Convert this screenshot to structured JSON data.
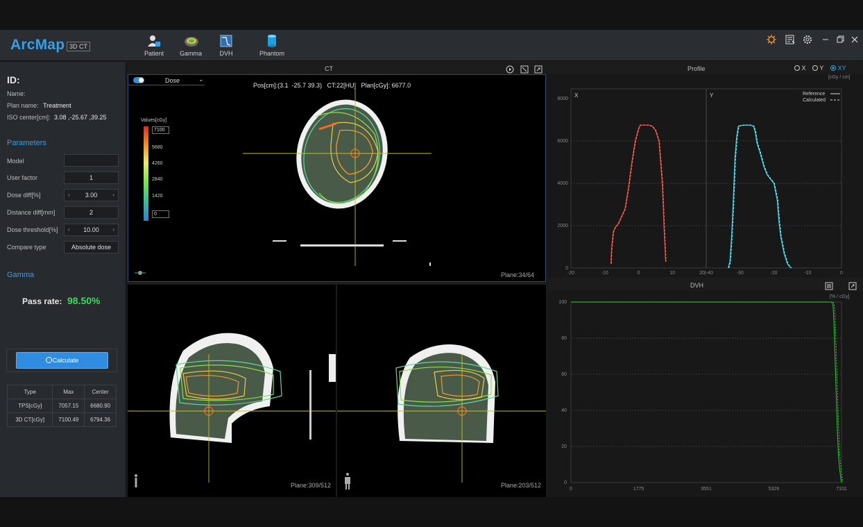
{
  "app": {
    "name": "ArcMap",
    "tag": "3D CT"
  },
  "toolbar": {
    "tools": [
      {
        "label": "Patient"
      },
      {
        "label": "Gamma"
      },
      {
        "label": "DVH"
      },
      {
        "label": "Phantom"
      }
    ]
  },
  "left": {
    "id_label": "ID:",
    "name_label": "Name:",
    "plan_label": "Plan name:",
    "plan_value": "Treatment",
    "iso_label": "ISO center[cm]:",
    "iso_value": "3.08 ,-25.67 ,39.25",
    "parameters_title": "Parameters",
    "params": [
      {
        "label": "Model",
        "value": ""
      },
      {
        "label": "User factor",
        "value": "1"
      },
      {
        "label": "Dose diff[%]",
        "value": "3.00"
      },
      {
        "label": "Distance diff[mm]",
        "value": "2"
      },
      {
        "label": "Dose threshold[%]",
        "value": "10.00"
      },
      {
        "label": "Compare type",
        "value": "Absolute dose"
      }
    ],
    "gamma_title": "Gamma",
    "pass_label": "Pass rate:",
    "pass_value": "98.50%",
    "calculate_label": "Calculate",
    "table": {
      "headers": [
        "Type",
        "Max",
        "Center"
      ],
      "rows": [
        [
          "TPS[cGy]",
          "7057.15",
          "6680.90"
        ],
        [
          "3D CT[cGy]",
          "7100.49",
          "6794.36"
        ]
      ]
    }
  },
  "ct": {
    "title": "CT",
    "dose_label": "Dose",
    "pos_text": "Pos[cm]:(3.1  -25.7 39.3)   CT:22[HU]   Plan[cGy]: 6677.0",
    "legend_title": "Values[cGy]",
    "legend_top": "7100",
    "legend_values": [
      "5680",
      "4260",
      "2840",
      "1420"
    ],
    "legend_bottom": "0",
    "plane_axial": "Plane:34/64",
    "plane_sag": "Plane:309/512",
    "plane_cor": "Plane:203/512"
  },
  "profile": {
    "title": "Profile",
    "options": [
      "X",
      "Y",
      "XY"
    ],
    "selected": "XY",
    "unit": "[cGy / cm]",
    "legend": [
      "Reference",
      "Calculated"
    ],
    "panel_x": "X",
    "panel_y": "Y",
    "y_ticks": [
      "8000",
      "6000",
      "4000",
      "2000",
      "0"
    ],
    "x_ticks": [
      "-20",
      "-10",
      "0",
      "10",
      "20|-40",
      "-30",
      "-20",
      "-10",
      "0"
    ]
  },
  "dvh": {
    "title": "DVH",
    "unit": "[% / cGy]",
    "y_ticks": [
      "100",
      "80",
      "60",
      "40",
      "20",
      "0"
    ],
    "x_ticks": [
      "0",
      "1775",
      "3551",
      "5326",
      "7101"
    ]
  },
  "colors": {
    "accent": "#3a9ee6",
    "pass": "#3ddc5a",
    "x_profile": "#e8423a",
    "y_profile": "#2fd4e6",
    "dvh": "#22c22a"
  }
}
